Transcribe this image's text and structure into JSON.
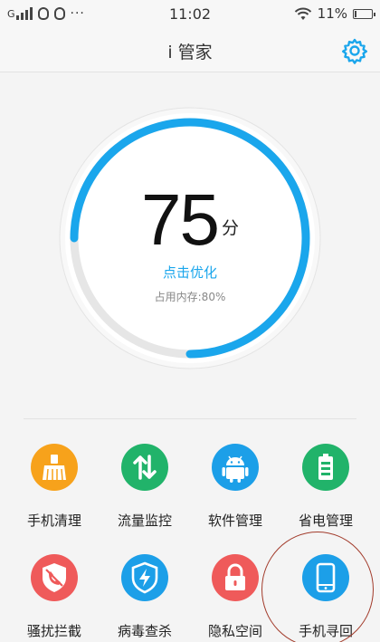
{
  "status_bar": {
    "carrier": "G",
    "time": "11:02",
    "battery_text": "11%",
    "battery_level": 0.11,
    "overflow_dots": "···"
  },
  "header": {
    "title": "i 管家",
    "settings_icon": "gear-icon"
  },
  "gauge": {
    "score": "75",
    "unit": "分",
    "score_fraction": 0.75,
    "optimize_label": "点击优化",
    "memory_text": "占用内存:80%",
    "accent_color": "#1aa6ec",
    "track_color": "#e6e6e6"
  },
  "tools": [
    {
      "label": "手机清理",
      "icon": "broom-icon",
      "color": "#f7a21b"
    },
    {
      "label": "流量监控",
      "icon": "data-arrows-icon",
      "color": "#21b36a"
    },
    {
      "label": "软件管理",
      "icon": "android-icon",
      "color": "#1c9fe8"
    },
    {
      "label": "省电管理",
      "icon": "battery-icon",
      "color": "#21b36a"
    },
    {
      "label": "骚扰拦截",
      "icon": "blocked-call-icon",
      "color": "#ef5a5a"
    },
    {
      "label": "病毒查杀",
      "icon": "shield-bolt-icon",
      "color": "#1c9fe8"
    },
    {
      "label": "隐私空间",
      "icon": "lock-icon",
      "color": "#ef5a5a"
    },
    {
      "label": "手机寻回",
      "icon": "phone-icon",
      "color": "#1c9fe8"
    }
  ],
  "annotation": {
    "ring_color": "#a23b2b"
  }
}
